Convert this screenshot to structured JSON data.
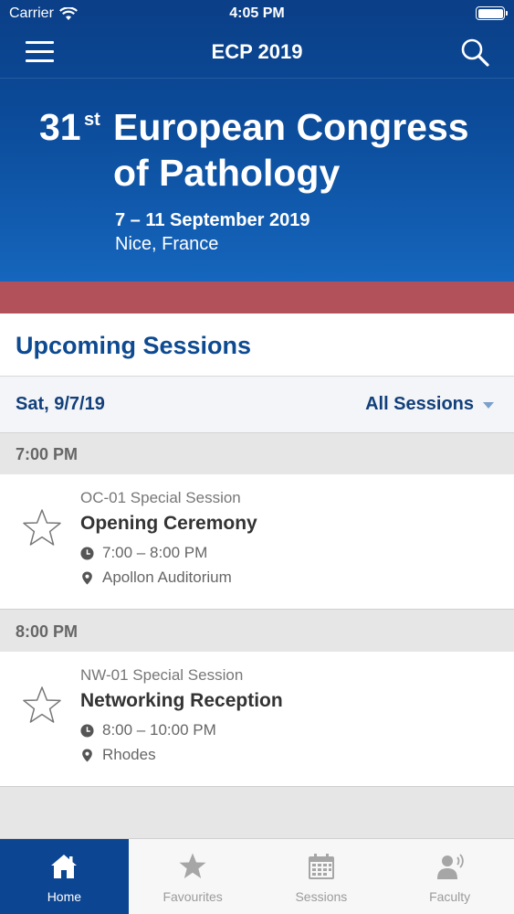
{
  "status_bar": {
    "carrier": "Carrier",
    "time": "4:05 PM"
  },
  "nav": {
    "title": "ECP 2019",
    "menu_icon": "hamburger-menu-icon",
    "search_icon": "search-icon"
  },
  "hero": {
    "number": "31",
    "superscript": "st",
    "title_line1": "European Congress",
    "title_line2": "of Pathology",
    "dates": "7 – 11 September 2019",
    "location": "Nice, France"
  },
  "section": {
    "title": "Upcoming Sessions"
  },
  "filter_bar": {
    "date": "Sat, 9/7/19",
    "filter_label": "All Sessions"
  },
  "groups": [
    {
      "time": "7:00 PM",
      "session": {
        "code": "OC-01 Special Session",
        "title": "Opening Ceremony",
        "time_range": "7:00 – 8:00 PM",
        "room": "Apollon Auditorium"
      }
    },
    {
      "time": "8:00 PM",
      "session": {
        "code": "NW-01 Special Session",
        "title": "Networking Reception",
        "time_range": "8:00 – 10:00 PM",
        "room": "Rhodes"
      }
    }
  ],
  "tabs": [
    {
      "label": "Home",
      "icon": "home-icon",
      "active": true
    },
    {
      "label": "Favourites",
      "icon": "star-icon",
      "active": false
    },
    {
      "label": "Sessions",
      "icon": "calendar-icon",
      "active": false
    },
    {
      "label": "Faculty",
      "icon": "speaker-icon",
      "active": false
    }
  ],
  "colors": {
    "brand_blue": "#0b4a98",
    "accent_red": "#b3515a",
    "title_blue": "#0d4a91"
  }
}
